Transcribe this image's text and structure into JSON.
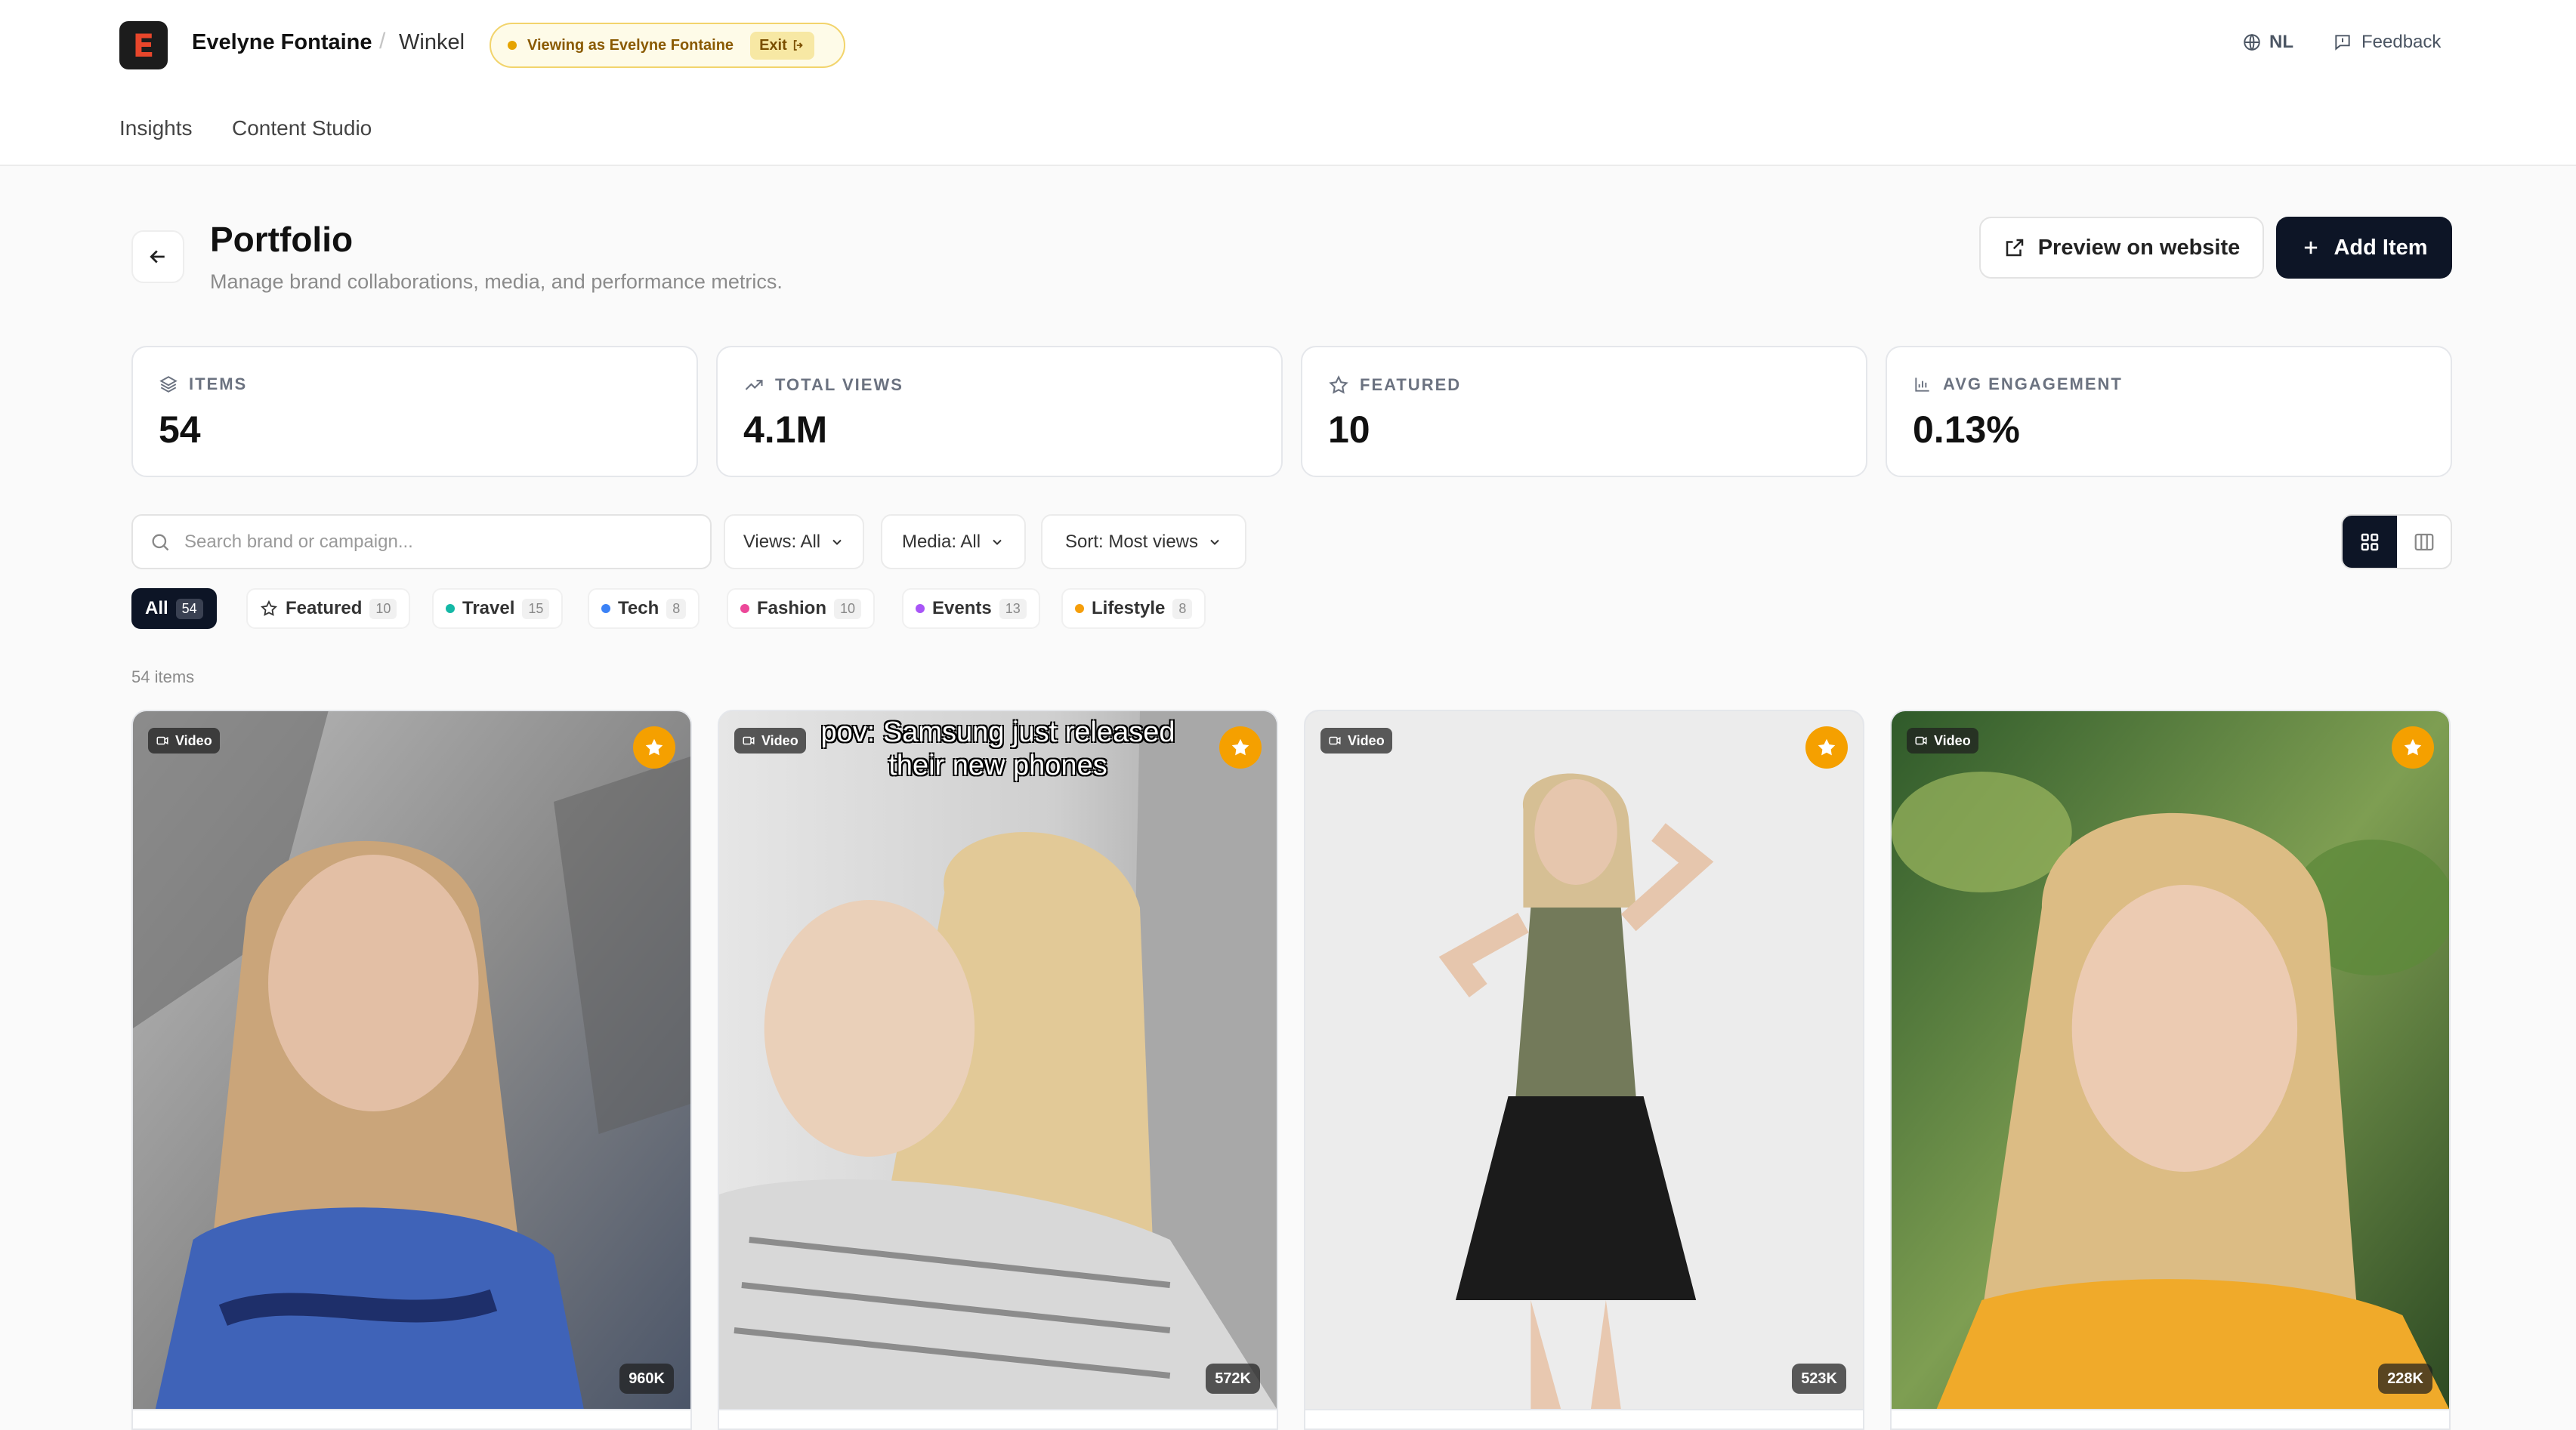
{
  "header": {
    "logo_letter": "E",
    "account_name": "Evelyne Fontaine",
    "separator": "/",
    "shop_name": "Winkel",
    "viewing_as": "Viewing as Evelyne Fontaine",
    "exit_label": "Exit",
    "language": "NL",
    "feedback_label": "Feedback"
  },
  "nav": {
    "insights": "Insights",
    "content_studio": "Content Studio"
  },
  "page": {
    "title": "Portfolio",
    "subtitle": "Manage brand collaborations, media, and performance metrics.",
    "preview_label": "Preview on website",
    "add_label": "Add Item"
  },
  "stats": [
    {
      "label": "ITEMS",
      "value": "54",
      "icon": "layers-icon"
    },
    {
      "label": "TOTAL VIEWS",
      "value": "4.1M",
      "icon": "trend-up-icon"
    },
    {
      "label": "FEATURED",
      "value": "10",
      "icon": "star-icon"
    },
    {
      "label": "AVG ENGAGEMENT",
      "value": "0.13%",
      "icon": "bar-chart-icon"
    }
  ],
  "filters": {
    "search_placeholder": "Search brand or campaign...",
    "views": "Views: All",
    "media": "Media: All",
    "sort": "Sort: Most views"
  },
  "chips": [
    {
      "label": "All",
      "count": "54",
      "active": true
    },
    {
      "label": "Featured",
      "count": "10",
      "icon": "star-outline-icon"
    },
    {
      "label": "Travel",
      "count": "15",
      "color": "#14b8a6"
    },
    {
      "label": "Tech",
      "count": "8",
      "color": "#3b82f6"
    },
    {
      "label": "Fashion",
      "count": "10",
      "color": "#ec4899"
    },
    {
      "label": "Events",
      "count": "13",
      "color": "#a855f7"
    },
    {
      "label": "Lifestyle",
      "count": "8",
      "color": "#f59e0b"
    }
  ],
  "item_count": "54 items",
  "cards": [
    {
      "type": "Video",
      "views": "960K",
      "featured": true,
      "caption": ""
    },
    {
      "type": "Video",
      "views": "572K",
      "featured": true,
      "caption_line1": "pov: Samsung just released",
      "caption_line2": "their new phones"
    },
    {
      "type": "Video",
      "views": "523K",
      "featured": true,
      "caption": ""
    },
    {
      "type": "Video",
      "views": "228K",
      "featured": true,
      "caption": ""
    }
  ],
  "colors": {
    "primary_dark": "#0d1526",
    "featured_star": "#f5a000",
    "logo_accent": "#e8462b"
  }
}
